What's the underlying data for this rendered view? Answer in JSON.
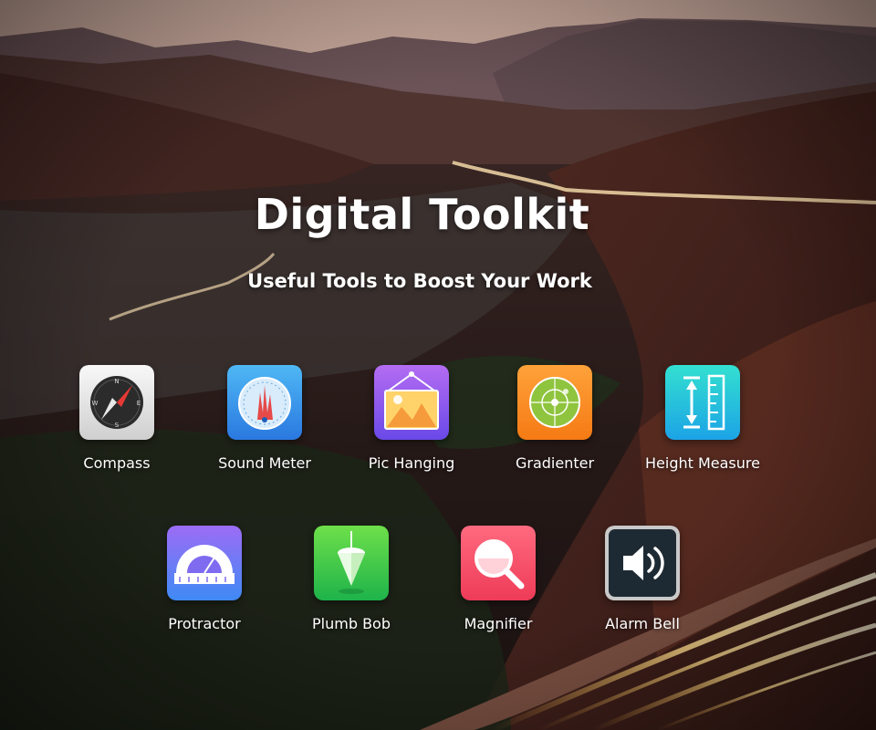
{
  "header": {
    "title": "Digital Toolkit",
    "subtitle": "Useful Tools to Boost Your Work"
  },
  "tools": [
    {
      "label": "Compass",
      "icon": "compass-icon"
    },
    {
      "label": "Sound Meter",
      "icon": "sound-meter-icon"
    },
    {
      "label": "Pic Hanging",
      "icon": "picture-frame-icon"
    },
    {
      "label": "Gradienter",
      "icon": "level-icon"
    },
    {
      "label": "Height Measure",
      "icon": "ruler-icon"
    },
    {
      "label": "Protractor",
      "icon": "protractor-icon"
    },
    {
      "label": "Plumb Bob",
      "icon": "plumb-bob-icon"
    },
    {
      "label": "Magnifier",
      "icon": "magnifier-icon"
    },
    {
      "label": "Alarm Bell",
      "icon": "speaker-icon"
    }
  ],
  "compass_letters": {
    "n": "N",
    "e": "E",
    "s": "S",
    "w": "W"
  },
  "colors": {
    "text": "#ffffff",
    "sky": "#e9cdbf",
    "ground": "#3b221d",
    "road_light": "#ffd79a"
  }
}
